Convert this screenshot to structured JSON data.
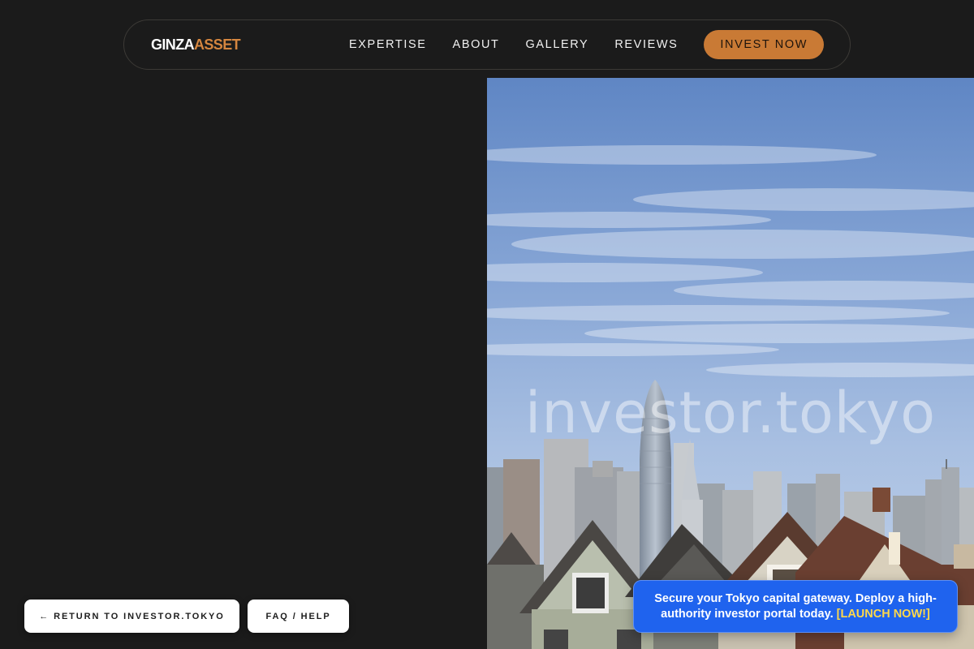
{
  "brand": {
    "logo_part1": "GINZA",
    "logo_part2": "ASSET",
    "accent_color": "#c97a35"
  },
  "nav": {
    "links": [
      {
        "label": "EXPERTISE"
      },
      {
        "label": "ABOUT"
      },
      {
        "label": "GALLERY"
      },
      {
        "label": "REVIEWS"
      }
    ],
    "cta_label": "INVEST NOW"
  },
  "hero": {
    "image_description_icon": "city-skyline-image",
    "watermark": "investor.tokyo"
  },
  "actions": {
    "return_label": "← RETURN TO INVESTOR.TOKYO",
    "faq_label": "FAQ / HELP"
  },
  "promo": {
    "text": "Secure your Tokyo capital gateway. Deploy a high-authority investor portal today.",
    "link_label": "[LAUNCH NOW!]",
    "background_color": "#1f63ee",
    "link_color": "#ffd84a"
  }
}
